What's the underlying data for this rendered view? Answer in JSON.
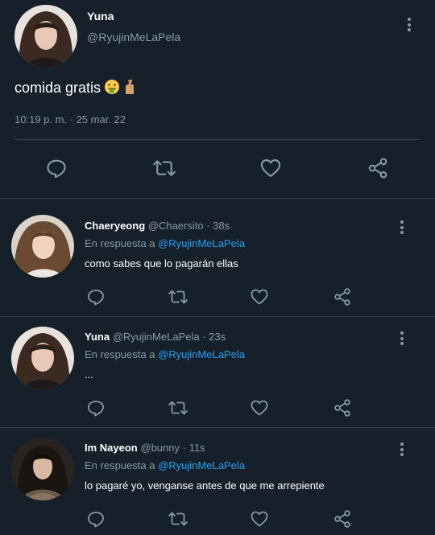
{
  "main_tweet": {
    "author_name": "Yuna",
    "author_handle": "@RyujinMeLaPela",
    "text": "comida gratis",
    "emojis": [
      "money-mouth-face-emoji",
      "crossed-fingers-emoji"
    ],
    "timestamp": "10:19 p. m. · 25 mar. 22",
    "actions": [
      "reply-icon",
      "retweet-icon",
      "like-icon",
      "share-icon"
    ]
  },
  "replies": [
    {
      "author_name": "Chaeryeong",
      "author_handle": "@Chaersito",
      "time": "· 38s",
      "reply_prefix": "En respuesta a",
      "reply_to": "@RyujinMeLaPela",
      "text": "como sabes que lo pagarán ellas"
    },
    {
      "author_name": "Yuna",
      "author_handle": "@RyujinMeLaPela",
      "time": "· 23s",
      "reply_prefix": "En respuesta a",
      "reply_to": "@RyujinMeLaPela",
      "text": "..."
    },
    {
      "author_name": "Im Nayeon",
      "author_handle": "@bunny",
      "time": "· 11s",
      "reply_prefix": "En respuesta a",
      "reply_to": "@RyujinMeLaPela",
      "text": "lo pagaré yo, venganse antes de que me arrepiente"
    }
  ],
  "colors": {
    "background": "#15202b",
    "secondary_text": "#8899a6",
    "link": "#1da1f2",
    "divider": "#38444d"
  }
}
